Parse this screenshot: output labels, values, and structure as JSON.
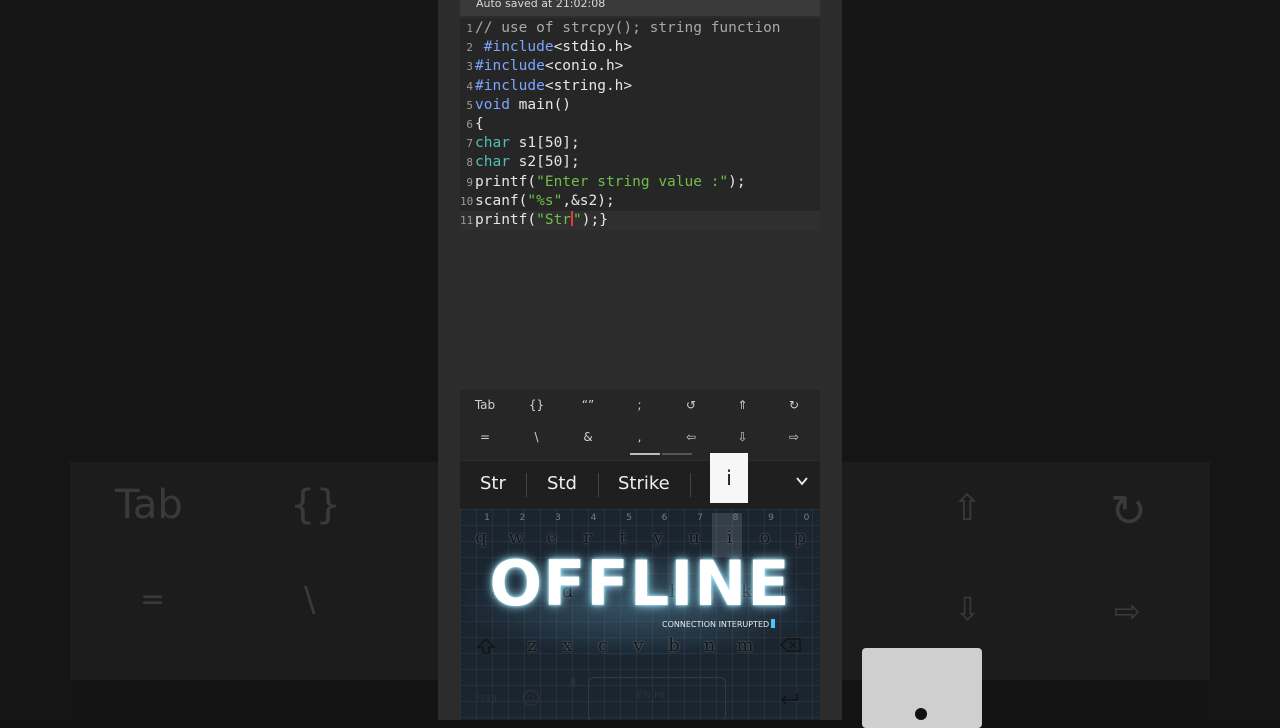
{
  "status": {
    "autosave": "Auto saved at 21:02:08"
  },
  "editor": {
    "lines": [
      {
        "num": "1",
        "parts": [
          {
            "t": "// use of strcpy(); string function",
            "c": "cm"
          }
        ]
      },
      {
        "num": "2",
        "parts": [
          {
            "t": " #include",
            "c": "kw"
          },
          {
            "t": "<stdio.h>",
            "c": ""
          }
        ]
      },
      {
        "num": "3",
        "parts": [
          {
            "t": "#include",
            "c": "kw"
          },
          {
            "t": "<conio.h>",
            "c": ""
          }
        ]
      },
      {
        "num": "4",
        "parts": [
          {
            "t": "#include",
            "c": "kw"
          },
          {
            "t": "<string.h>",
            "c": ""
          }
        ]
      },
      {
        "num": "5",
        "parts": [
          {
            "t": "void",
            "c": "kw"
          },
          {
            "t": " main()",
            "c": ""
          }
        ]
      },
      {
        "num": "6",
        "parts": [
          {
            "t": "{",
            "c": ""
          }
        ]
      },
      {
        "num": "7",
        "parts": [
          {
            "t": "char",
            "c": "tp"
          },
          {
            "t": " s1[50];",
            "c": ""
          }
        ]
      },
      {
        "num": "8",
        "parts": [
          {
            "t": "char",
            "c": "tp"
          },
          {
            "t": " s2[50];",
            "c": ""
          }
        ]
      },
      {
        "num": "9",
        "parts": [
          {
            "t": "printf(",
            "c": ""
          },
          {
            "t": "\"Enter string value :\"",
            "c": "str"
          },
          {
            "t": ");",
            "c": ""
          }
        ]
      },
      {
        "num": "10",
        "parts": [
          {
            "t": "scanf(",
            "c": ""
          },
          {
            "t": "\"%s\"",
            "c": "str"
          },
          {
            "t": ",&s2);",
            "c": ""
          }
        ]
      },
      {
        "num": "11",
        "parts": [
          {
            "t": "printf(",
            "c": ""
          },
          {
            "t": "\"Str",
            "c": "str"
          },
          {
            "t": "|",
            "c": "caret"
          },
          {
            "t": "\"",
            "c": "str"
          },
          {
            "t": ");}",
            "c": ""
          }
        ]
      }
    ]
  },
  "symbols": {
    "row1": [
      "Tab",
      "{}",
      "“”",
      ";",
      "↺",
      "⇑",
      "↻"
    ],
    "row2": [
      "=",
      "\\",
      "&",
      ",",
      "⇦",
      "⇩",
      "⇨"
    ]
  },
  "suggestions": {
    "items": [
      "Str",
      "Std",
      "Strike"
    ],
    "popup": "i"
  },
  "keyboard": {
    "row1": [
      "q",
      "w",
      "e",
      "r",
      "t",
      "y",
      "u",
      "i",
      "o",
      "p"
    ],
    "row1_nums": [
      "1",
      "2",
      "3",
      "4",
      "5",
      "6",
      "7",
      "8",
      "9",
      "0"
    ],
    "row2": [
      "a",
      "s",
      "d",
      "f",
      "g",
      "h",
      "j",
      "k",
      "l"
    ],
    "row3": [
      "z",
      "x",
      "c",
      "v",
      "b",
      "n",
      "m"
    ],
    "banner": "OFFLINE",
    "banner_sub": "CONNECTION INTERUPTED",
    "sym_key": "?१२३",
    "space_label": "EN·HI"
  },
  "background": {
    "keys": [
      "Tab",
      "{}",
      "⇧",
      "↻",
      "=",
      "\\",
      "⇩",
      "⇨"
    ]
  }
}
